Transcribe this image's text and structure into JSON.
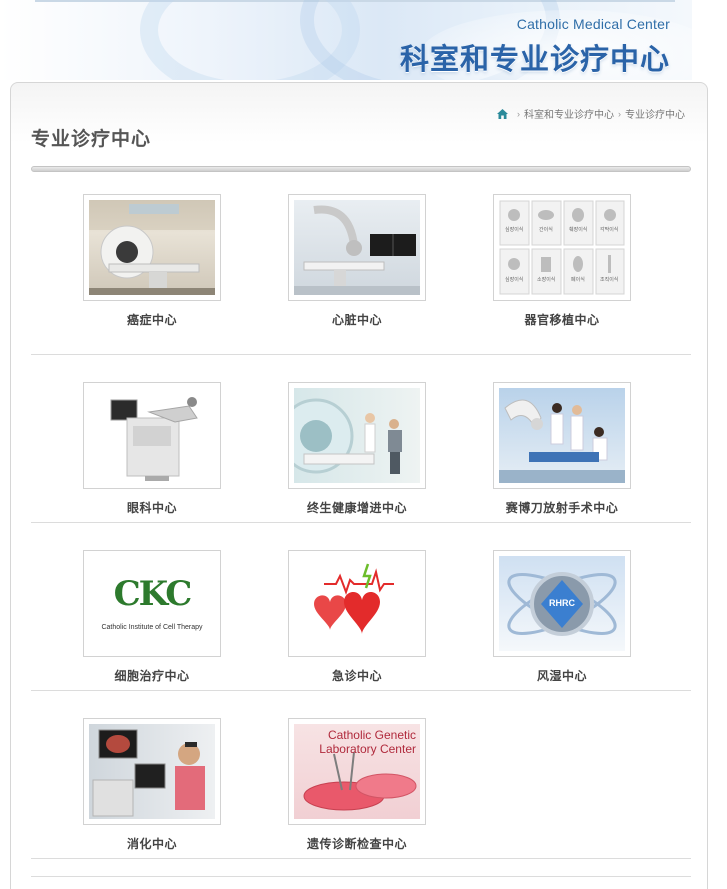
{
  "banner": {
    "english": "Catholic Medical Center",
    "chinese": "科室和专业诊疗中心"
  },
  "breadcrumb": {
    "items": [
      "科室和专业诊疗中心",
      "专业诊疗中心"
    ]
  },
  "page_title": "专业诊疗中心",
  "centers": [
    {
      "label": "癌症中心"
    },
    {
      "label": "心脏中心"
    },
    {
      "label": "器官移植中心"
    },
    {
      "label": "眼科中心"
    },
    {
      "label": "终生健康增进中心"
    },
    {
      "label": "赛博刀放射手术中心"
    },
    {
      "label": "细胞治疗中心"
    },
    {
      "label": "急诊中心"
    },
    {
      "label": "风湿中心"
    },
    {
      "label": "消化中心"
    },
    {
      "label": "遗传诊断检查中心"
    }
  ],
  "image_text": {
    "cicc_logo": "CKC",
    "cicc_caption": "Catholic Institute of Cell Therapy",
    "rhrc": "RHRC",
    "genetic_line1": "Catholic Genetic",
    "genetic_line2": "Laboratory Center",
    "organ_tiles": [
      "심장이식",
      "간이식",
      "췌장이식",
      "각막이식",
      "심장이식",
      "소장이식",
      "폐이식",
      "조직이식"
    ]
  },
  "colors": {
    "brand_blue": "#2a63a8",
    "cicc_green": "#2d7a2d",
    "emergency_red": "#e32b2b"
  }
}
